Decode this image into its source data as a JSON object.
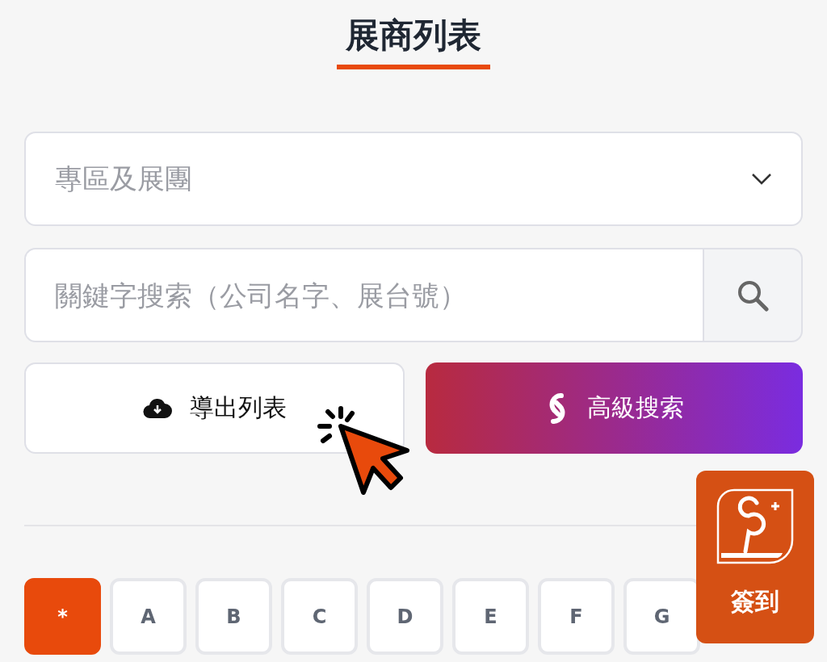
{
  "title": "展商列表",
  "zone_select": {
    "placeholder": "專區及展團"
  },
  "search": {
    "placeholder": "關鍵字搜索（公司名字、展台號）"
  },
  "buttons": [
    {
      "kind": "export",
      "label": "導出列表"
    },
    {
      "kind": "advanced",
      "label": "高級搜索"
    }
  ],
  "letters": [
    {
      "label": "*",
      "selected": true
    },
    {
      "label": "A",
      "selected": false
    },
    {
      "label": "B",
      "selected": false
    },
    {
      "label": "C",
      "selected": false
    },
    {
      "label": "D",
      "selected": false
    },
    {
      "label": "E",
      "selected": false
    },
    {
      "label": "F",
      "selected": false
    },
    {
      "label": "G",
      "selected": false
    }
  ],
  "checkin": {
    "label": "簽到"
  }
}
